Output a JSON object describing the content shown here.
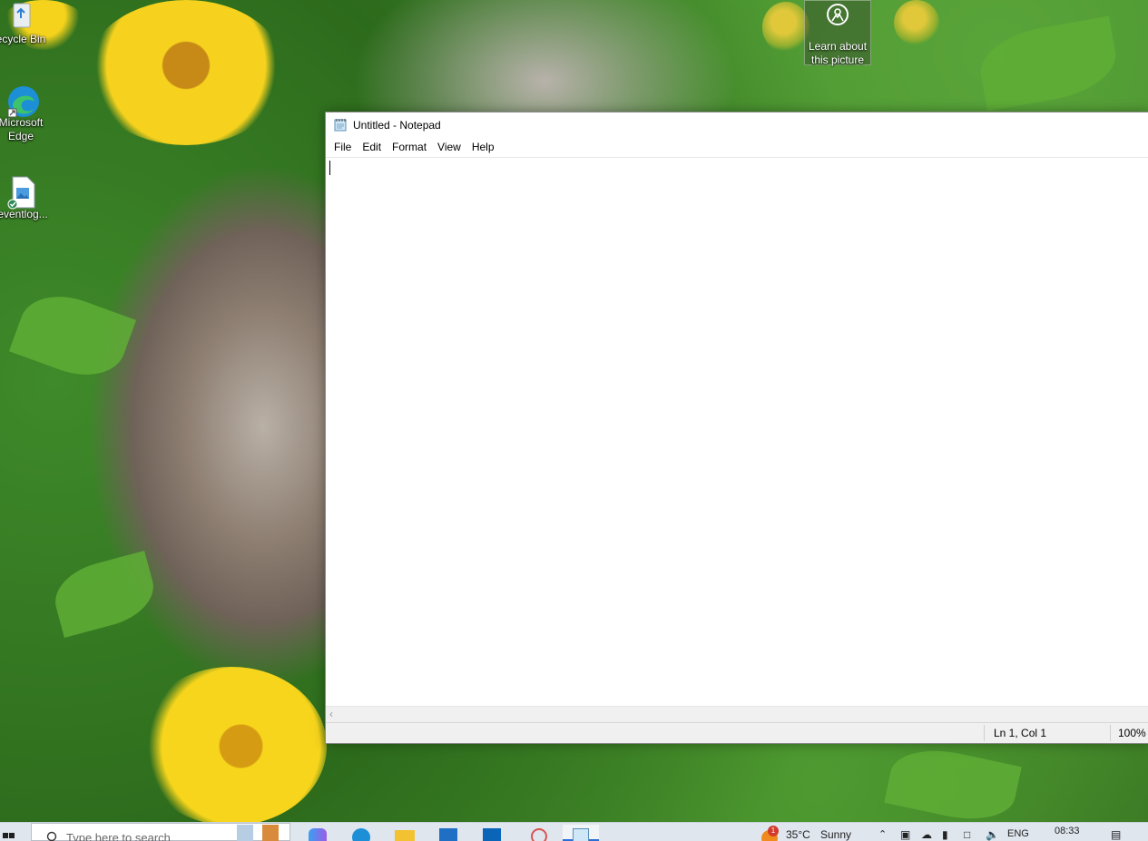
{
  "desktop": {
    "icons": [
      {
        "label": "ecycle Bin",
        "icon": "recycle-bin-icon"
      },
      {
        "label": "Microsoft Edge",
        "icon": "edge-icon"
      },
      {
        "label": "eventlog...",
        "icon": "image-file-icon"
      }
    ],
    "learn_about": {
      "line1": "Learn about",
      "line2": "this picture",
      "icon": "camera-circle-icon"
    }
  },
  "notepad": {
    "title": "Untitled - Notepad",
    "menu": [
      "File",
      "Edit",
      "Format",
      "View",
      "Help"
    ],
    "content": "",
    "status": {
      "position": "Ln 1, Col 1",
      "zoom": "100%"
    }
  },
  "taskbar": {
    "search_placeholder": "Type here to search",
    "weather": {
      "temp": "35°C",
      "condition": "Sunny",
      "badge": "1"
    },
    "language": "ENG",
    "time": "08:33",
    "accent": "#2b6fd6"
  }
}
